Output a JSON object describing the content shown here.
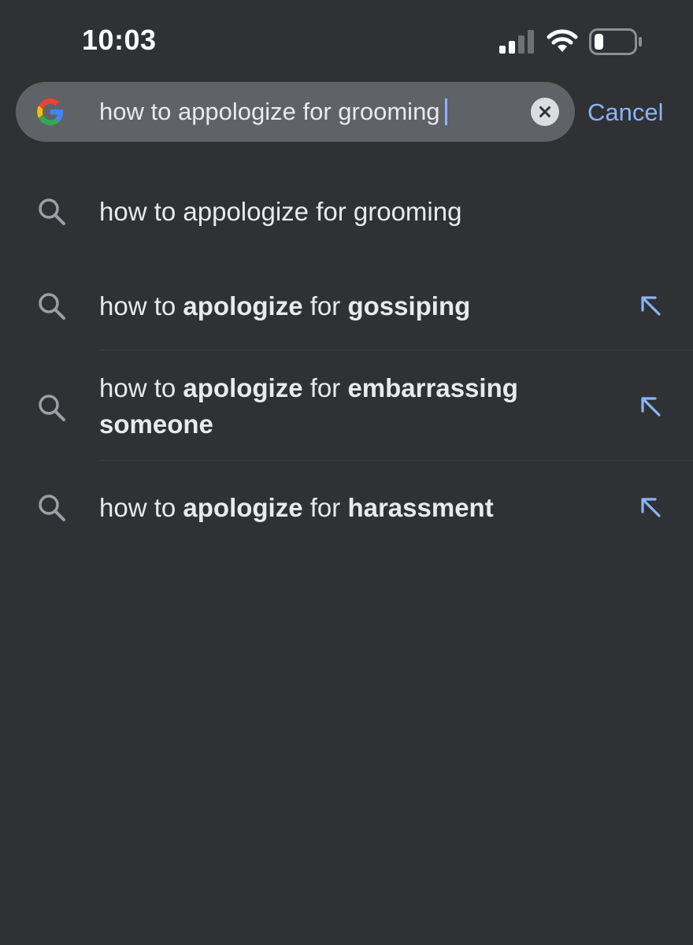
{
  "status_bar": {
    "time": "10:03"
  },
  "search": {
    "query": "how to appologize for grooming",
    "cancel_label": "Cancel"
  },
  "suggestions": [
    {
      "parts": [
        {
          "t": "how to appologize for grooming",
          "b": false
        }
      ]
    },
    {
      "parts": [
        {
          "t": "how to ",
          "b": false
        },
        {
          "t": "apologize",
          "b": true
        },
        {
          "t": " for ",
          "b": false
        },
        {
          "t": "gossiping",
          "b": true
        }
      ]
    },
    {
      "parts": [
        {
          "t": "how to ",
          "b": false
        },
        {
          "t": "apologize",
          "b": true
        },
        {
          "t": " for ",
          "b": false
        },
        {
          "t": "embarrassing someone",
          "b": true
        }
      ]
    },
    {
      "parts": [
        {
          "t": "how to ",
          "b": false
        },
        {
          "t": "apologize",
          "b": true
        },
        {
          "t": " for ",
          "b": false
        },
        {
          "t": "harassment",
          "b": true
        }
      ]
    }
  ],
  "icons": {
    "logo": "google-g-icon",
    "clear": "clear-icon",
    "suggestion": "search-icon",
    "fill": "arrow-up-left-icon",
    "signal": "cellular-signal-icon",
    "wifi": "wifi-icon",
    "battery": "battery-icon"
  },
  "colors": {
    "background": "#303134",
    "search_bar": "#5f6368",
    "accent": "#8ab4f8",
    "text": "#e8eaed"
  }
}
